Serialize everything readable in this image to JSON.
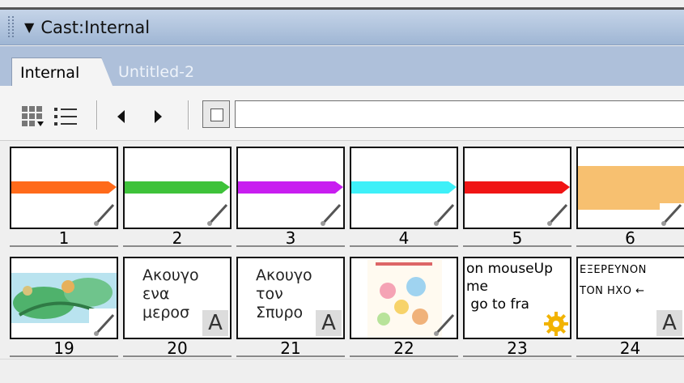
{
  "window": {
    "title": "Cast:Internal"
  },
  "tabs": [
    {
      "label": "Internal",
      "active": true
    },
    {
      "label": "Untitled-2",
      "active": false
    }
  ],
  "toolbar": {
    "view_thumbnail_icon": "thumbnail-grid-icon",
    "view_list_icon": "list-view-icon",
    "prev_icon": "arrow-left-icon",
    "next_icon": "arrow-right-icon",
    "member_name": ""
  },
  "cast_members": [
    {
      "number": "1",
      "kind": "bitmap",
      "stroke_color": "#ff6a1a"
    },
    {
      "number": "2",
      "kind": "bitmap",
      "stroke_color": "#3ec23a"
    },
    {
      "number": "3",
      "kind": "bitmap",
      "stroke_color": "#c81ef0"
    },
    {
      "number": "4",
      "kind": "bitmap",
      "stroke_color": "#3ef0f8"
    },
    {
      "number": "5",
      "kind": "bitmap",
      "stroke_color": "#f01414"
    },
    {
      "number": "6",
      "kind": "bitmap",
      "fill_color": "#f7c070"
    },
    {
      "number": "19",
      "kind": "bitmap-image"
    },
    {
      "number": "20",
      "kind": "text",
      "text": "Ακουγο\nενα\nμεροσ"
    },
    {
      "number": "21",
      "kind": "text",
      "text": "Ακουγο\nτον\nΣπυρο"
    },
    {
      "number": "22",
      "kind": "bitmap-image"
    },
    {
      "number": "23",
      "kind": "script",
      "text": "on mouseUp\nme\n go to fra"
    },
    {
      "number": "24",
      "kind": "text",
      "text": "ΕΞΕΡΕΥΝΟΝ\nΤΟΝ ΗΧΟ ←"
    }
  ]
}
